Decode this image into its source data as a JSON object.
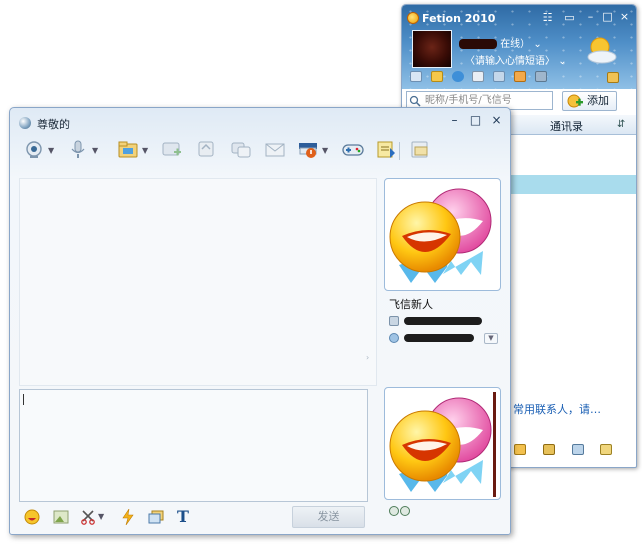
{
  "main_window": {
    "title": "Fetion 2010",
    "status_text": "在线）",
    "mood_placeholder": "〈请输入心情短语〉",
    "search_placeholder": "昵称/手机号/飞信号",
    "add_button": "添加",
    "tab_contacts": "通讯录",
    "sort_icon": "⇵",
    "hint_text": "常用联系人，请…",
    "icons": [
      "home-icon",
      "mail-icon",
      "app-icon",
      "doc-icon",
      "group-icon",
      "game-icon",
      "tools-icon"
    ],
    "bottom_icons": [
      "mail-icon",
      "chat-icon",
      "message-icon",
      "app-icon"
    ]
  },
  "chat_window": {
    "title": "尊敬的",
    "toolbar": [
      "video-icon",
      "voice-icon",
      "file-icon",
      "add-contact-icon",
      "short-message-icon",
      "group-chat-icon",
      "email-icon",
      "alert-icon",
      "game-icon",
      "notes-icon",
      "history-icon"
    ],
    "bottom_icons": [
      "emoticon-icon",
      "image-icon",
      "screenshot-icon",
      "nudge-icon",
      "window-icon",
      "font-icon"
    ],
    "font_glyph": "T",
    "send_button": "发送",
    "contact": {
      "name": "飞信新人"
    },
    "win_controls": {
      "minimize": "–",
      "maximize": "□",
      "close": "×"
    }
  },
  "colors": {
    "accent_blue": "#4f8fc8",
    "selection": "#a9dced",
    "link": "#1a5fb4"
  }
}
